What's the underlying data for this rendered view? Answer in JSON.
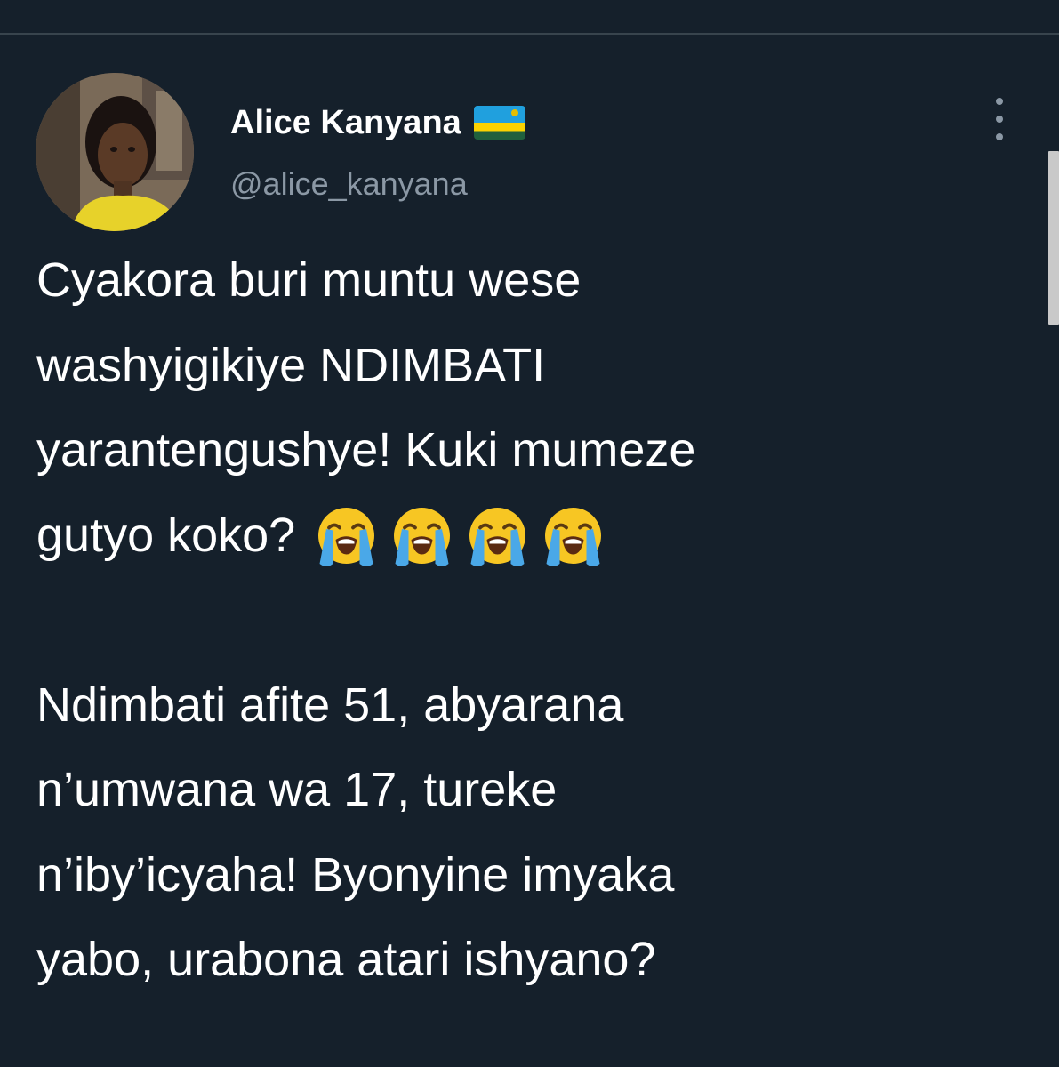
{
  "tweet": {
    "author": {
      "display_name": "Alice Kanyana",
      "flag_icon": "rwanda-flag-icon",
      "handle": "@alice_kanyana",
      "avatar_icon": "profile-photo"
    },
    "menu_icon": "more-options-icon",
    "text_lines": [
      "Cyakora buri muntu wese",
      "washyigikiye NDIMBATI",
      "yarantengushye! Kuki mumeze",
      "gutyo koko?"
    ],
    "emoji_icon": "loudly-crying-face-emoji",
    "emoji_count": 4,
    "text_lines_2": [
      "Ndimbati afite 51, abyarana",
      "n’umwana wa 17, tureke",
      "n’iby’icyaha! Byonyine imyaka",
      "yabo, urabona atari ishyano?"
    ]
  },
  "colors": {
    "background": "#15202b",
    "text": "#ffffff",
    "secondary_text": "#8b98a5",
    "divider": "#38444d"
  }
}
